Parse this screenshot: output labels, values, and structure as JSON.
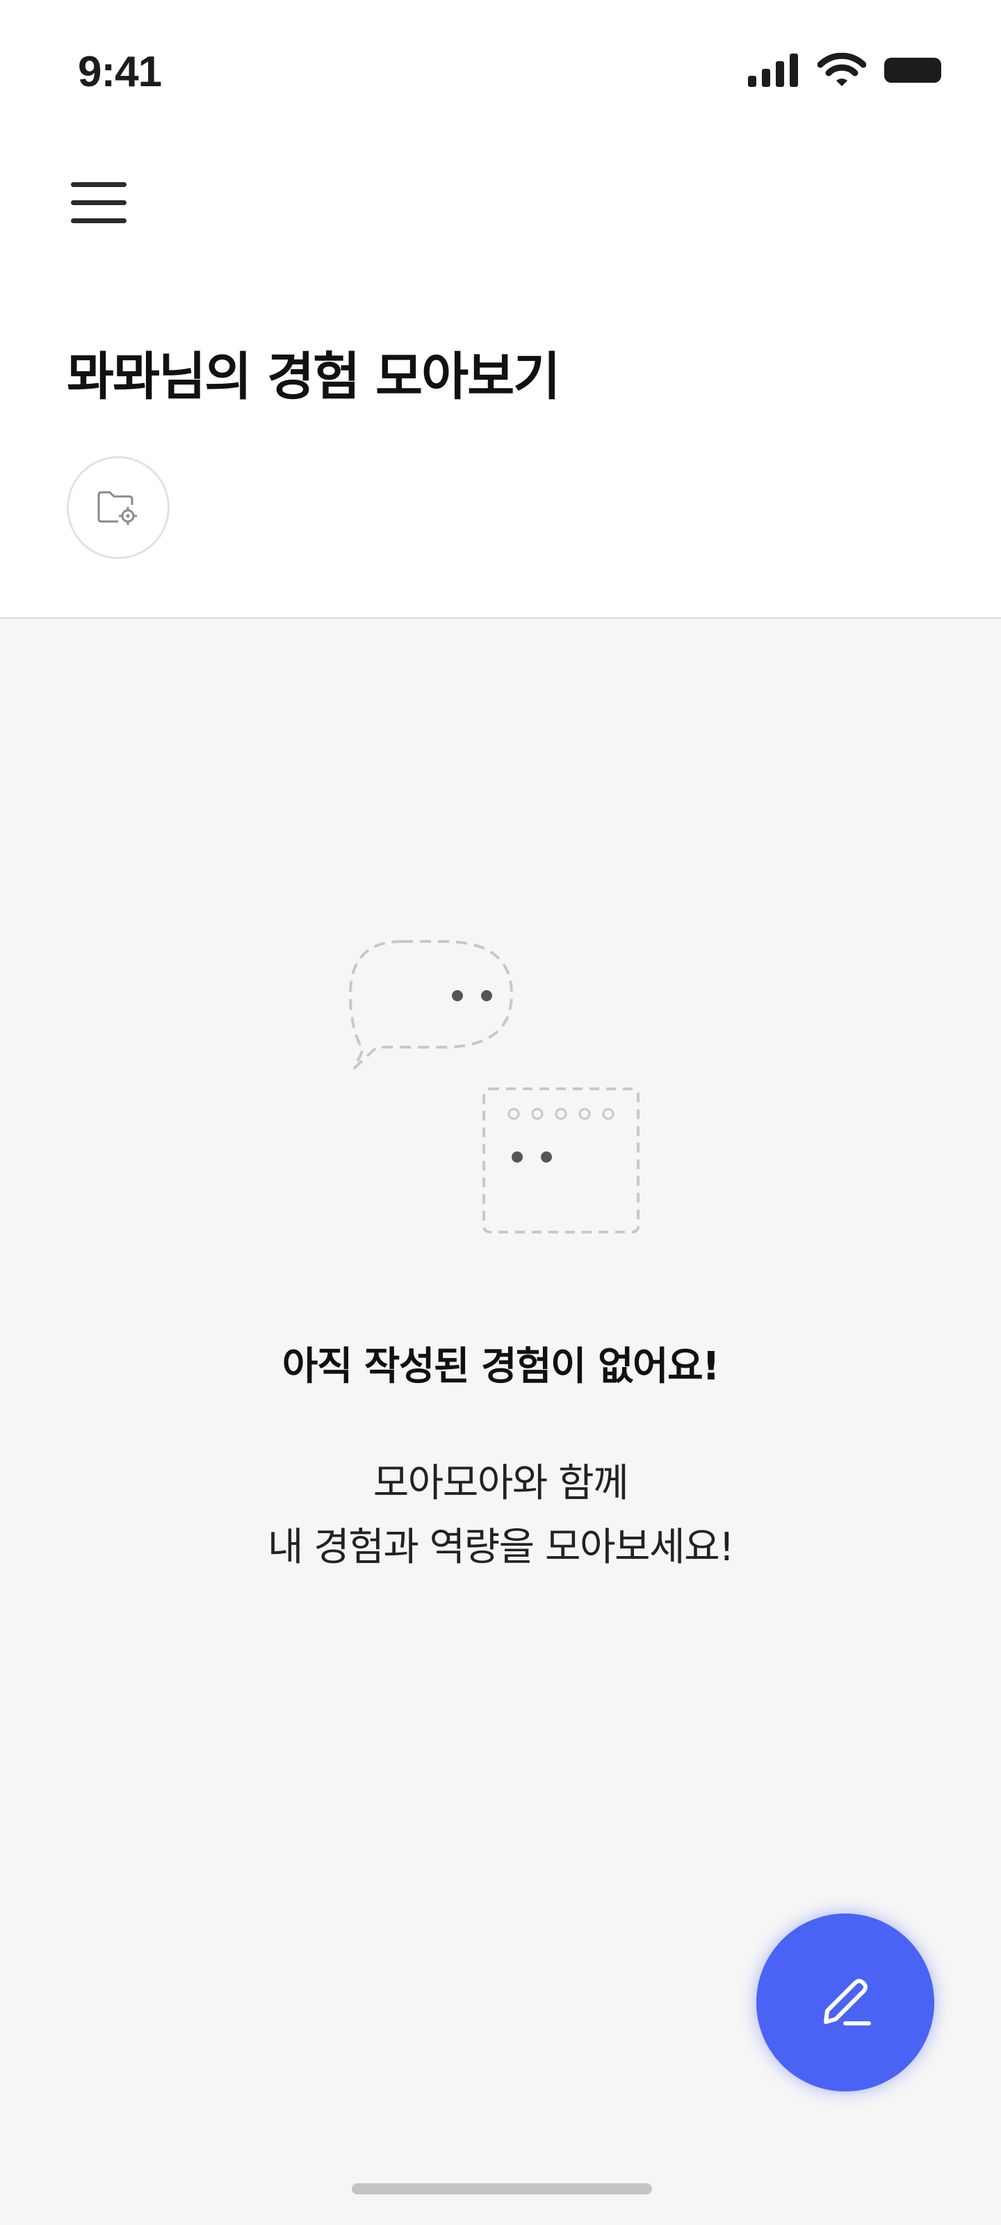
{
  "status_bar": {
    "time": "9:41",
    "icons": [
      "cellular-signal-icon",
      "wifi-icon",
      "battery-icon"
    ]
  },
  "header": {
    "menu_icon": "hamburger-menu-icon",
    "title": "뫄뫄님의 경험 모아보기",
    "folder_settings_icon": "folder-settings-icon"
  },
  "empty_state": {
    "illustration_icon": "empty-chat-illustration",
    "title": "아직 작성된 경험이 없어요!",
    "description_line1": "모아모아와 함께",
    "description_line2": "내 경험과 역량을 모아보세요!"
  },
  "fab": {
    "icon": "pencil-icon"
  },
  "colors": {
    "accent": "#4a63f4",
    "header_background": "#ffffff",
    "content_background": "#f6f6f6",
    "divider": "#dcdcdc"
  }
}
